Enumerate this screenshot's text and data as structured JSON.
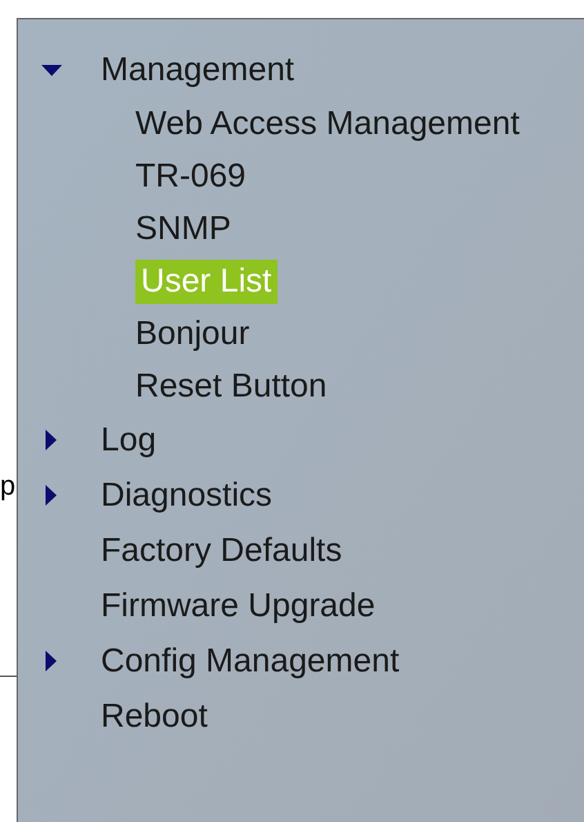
{
  "side_text": "p",
  "menu": [
    {
      "label": "Management",
      "expanded": true,
      "children": [
        {
          "label": "Web Access Management",
          "selected": false
        },
        {
          "label": "TR-069",
          "selected": false
        },
        {
          "label": "SNMP",
          "selected": false
        },
        {
          "label": "User List",
          "selected": true
        },
        {
          "label": "Bonjour",
          "selected": false
        },
        {
          "label": "Reset Button",
          "selected": false
        }
      ]
    },
    {
      "label": "Log",
      "expanded": false
    },
    {
      "label": "Diagnostics",
      "expanded": false
    },
    {
      "label": "Factory Defaults"
    },
    {
      "label": "Firmware Upgrade"
    },
    {
      "label": "Config Management",
      "expanded": false
    },
    {
      "label": "Reboot"
    }
  ]
}
